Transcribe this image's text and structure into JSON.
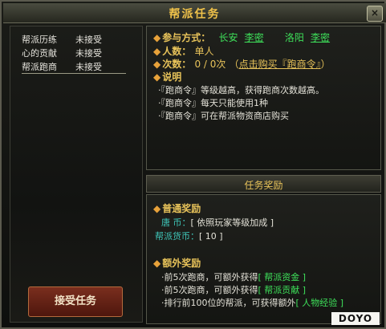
{
  "window": {
    "title": "帮派任务",
    "close_label": "×"
  },
  "quest_list": [
    {
      "name": "帮派历练",
      "status": "未接受"
    },
    {
      "name": "心的贡献",
      "status": "未接受"
    },
    {
      "name": "帮派跑商",
      "status": "未接受"
    }
  ],
  "accept_button": "接受任务",
  "info": {
    "participation_label": "参与方式：",
    "location1": "长安",
    "npc1": "李密",
    "location2": "洛阳",
    "npc2": "李密",
    "people_label": "人数：",
    "people_value": "单人",
    "times_label": "次数：",
    "times_value": "0 / 0次",
    "buy_paren_open": "（",
    "buy_link": "点击购买『跑商令』",
    "buy_paren_close": "）",
    "desc_label": "说明",
    "desc_lines": [
      "·『跑商令』等级越高，获得跑商次数越高。",
      "·『跑商令』每天只能使用1种",
      "·『跑商令』可在帮派物资商店购买"
    ]
  },
  "rewards": {
    "header": "任务奖励",
    "normal_label": "普通奖励",
    "normal_items": [
      {
        "label": "唐    币：",
        "value": "[ 依照玩家等级加成 ]"
      },
      {
        "label": "帮派货币：",
        "value": "[ 10 ]"
      }
    ],
    "extra_label": "额外奖励",
    "extra_items": [
      {
        "text": "·前5次跑商，可额外获得",
        "reward": "[ 帮派资金 ]"
      },
      {
        "text": "·前5次跑商，可额外获得",
        "reward": "[ 帮派贡献 ]"
      },
      {
        "text": "·排行前100位的帮派，可获得额外",
        "reward": "[ 人物经验 ]"
      }
    ]
  },
  "logo_text": "DOYO"
}
